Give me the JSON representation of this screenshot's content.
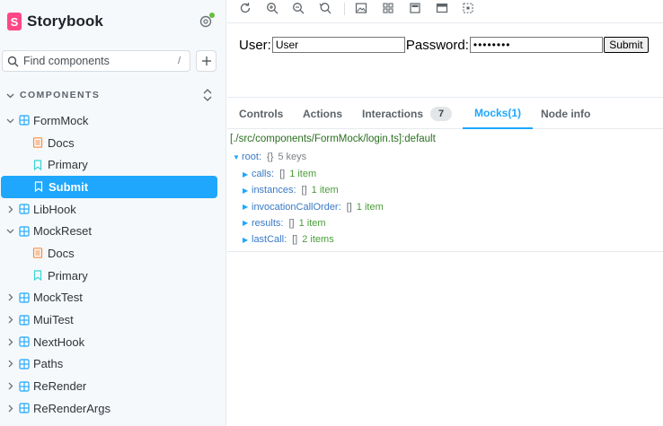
{
  "sidebar": {
    "brand": "Storybook",
    "brand_logo_letter": "S",
    "search": {
      "placeholder": "Find components",
      "shortcut": "/"
    },
    "section": "COMPONENTS",
    "tree": [
      {
        "label": "FormMock",
        "kind": "component",
        "level": 0,
        "expanded": true
      },
      {
        "label": "Docs",
        "kind": "docs",
        "level": 1
      },
      {
        "label": "Primary",
        "kind": "story",
        "level": 1
      },
      {
        "label": "Submit",
        "kind": "story",
        "level": 1,
        "selected": true
      },
      {
        "label": "LibHook",
        "kind": "component",
        "level": 0,
        "expanded": false
      },
      {
        "label": "MockReset",
        "kind": "component",
        "level": 0,
        "expanded": true
      },
      {
        "label": "Docs",
        "kind": "docs",
        "level": 1
      },
      {
        "label": "Primary",
        "kind": "story",
        "level": 1
      },
      {
        "label": "MockTest",
        "kind": "component",
        "level": 0,
        "expanded": false
      },
      {
        "label": "MuiTest",
        "kind": "component",
        "level": 0,
        "expanded": false
      },
      {
        "label": "NextHook",
        "kind": "component",
        "level": 0,
        "expanded": false
      },
      {
        "label": "Paths",
        "kind": "component",
        "level": 0,
        "expanded": false
      },
      {
        "label": "ReRender",
        "kind": "component",
        "level": 0,
        "expanded": false
      },
      {
        "label": "ReRenderArgs",
        "kind": "component",
        "level": 0,
        "expanded": false
      }
    ]
  },
  "toolbar": {
    "buttons": [
      "reload-icon",
      "zoom-in-icon",
      "zoom-out-icon",
      "zoom-reset-icon",
      "image-icon",
      "grid-icon",
      "sidebar-icon",
      "panel-icon",
      "outline-icon"
    ]
  },
  "preview": {
    "user_label": "User:",
    "user_value": "User",
    "password_label": "Password:",
    "password_value": "password",
    "submit_label": "Submit"
  },
  "addons": {
    "tabs": [
      {
        "label": "Controls"
      },
      {
        "label": "Actions"
      },
      {
        "label": "Interactions",
        "badge": "7"
      },
      {
        "label": "Mocks(1)",
        "active": true
      },
      {
        "label": "Node info"
      }
    ],
    "mocks": {
      "path": "[./src/components/FormMock/login.ts]:default",
      "root": {
        "key": "root:",
        "bracket": "{}",
        "meta": "5 keys"
      },
      "entries": [
        {
          "key": "calls:",
          "bracket": "[]",
          "meta": "1 item"
        },
        {
          "key": "instances:",
          "bracket": "[]",
          "meta": "1 item"
        },
        {
          "key": "invocationCallOrder:",
          "bracket": "[]",
          "meta": "1 item"
        },
        {
          "key": "results:",
          "bracket": "[]",
          "meta": "1 item"
        },
        {
          "key": "lastCall:",
          "bracket": "[]",
          "meta": "2 items"
        }
      ]
    }
  },
  "colors": {
    "accent": "#1ea7fd",
    "brand": "#ff4785",
    "badge_dot": "#66bf3c"
  }
}
